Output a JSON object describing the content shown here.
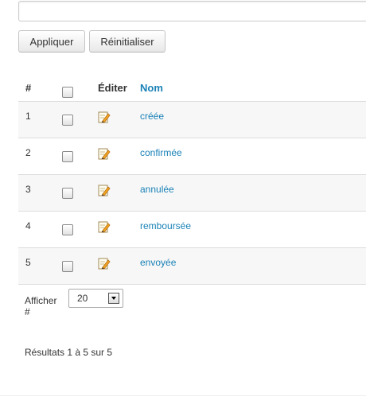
{
  "filter": {
    "search_value": "",
    "search_placeholder": ""
  },
  "toolbar": {
    "apply_label": "Appliquer",
    "reset_label": "Réinitialiser"
  },
  "table": {
    "headers": {
      "num": "#",
      "edit": "Éditer",
      "name": "Nom"
    },
    "rows": [
      {
        "num": "1",
        "name": "créée"
      },
      {
        "num": "2",
        "name": "confirmée"
      },
      {
        "num": "3",
        "name": "annulée"
      },
      {
        "num": "4",
        "name": "remboursée"
      },
      {
        "num": "5",
        "name": "envoyée"
      }
    ]
  },
  "pagination": {
    "limit_label": "Afficher #",
    "limit_value": "20",
    "results_text": "Résultats 1 à 5 sur 5"
  },
  "icons": {
    "edit": "edit-pencil-icon",
    "dropdown": "chevron-down-icon"
  },
  "colors": {
    "link": "#1a82b7",
    "row_alt": "#f7f7f7",
    "border": "#dddddd"
  }
}
